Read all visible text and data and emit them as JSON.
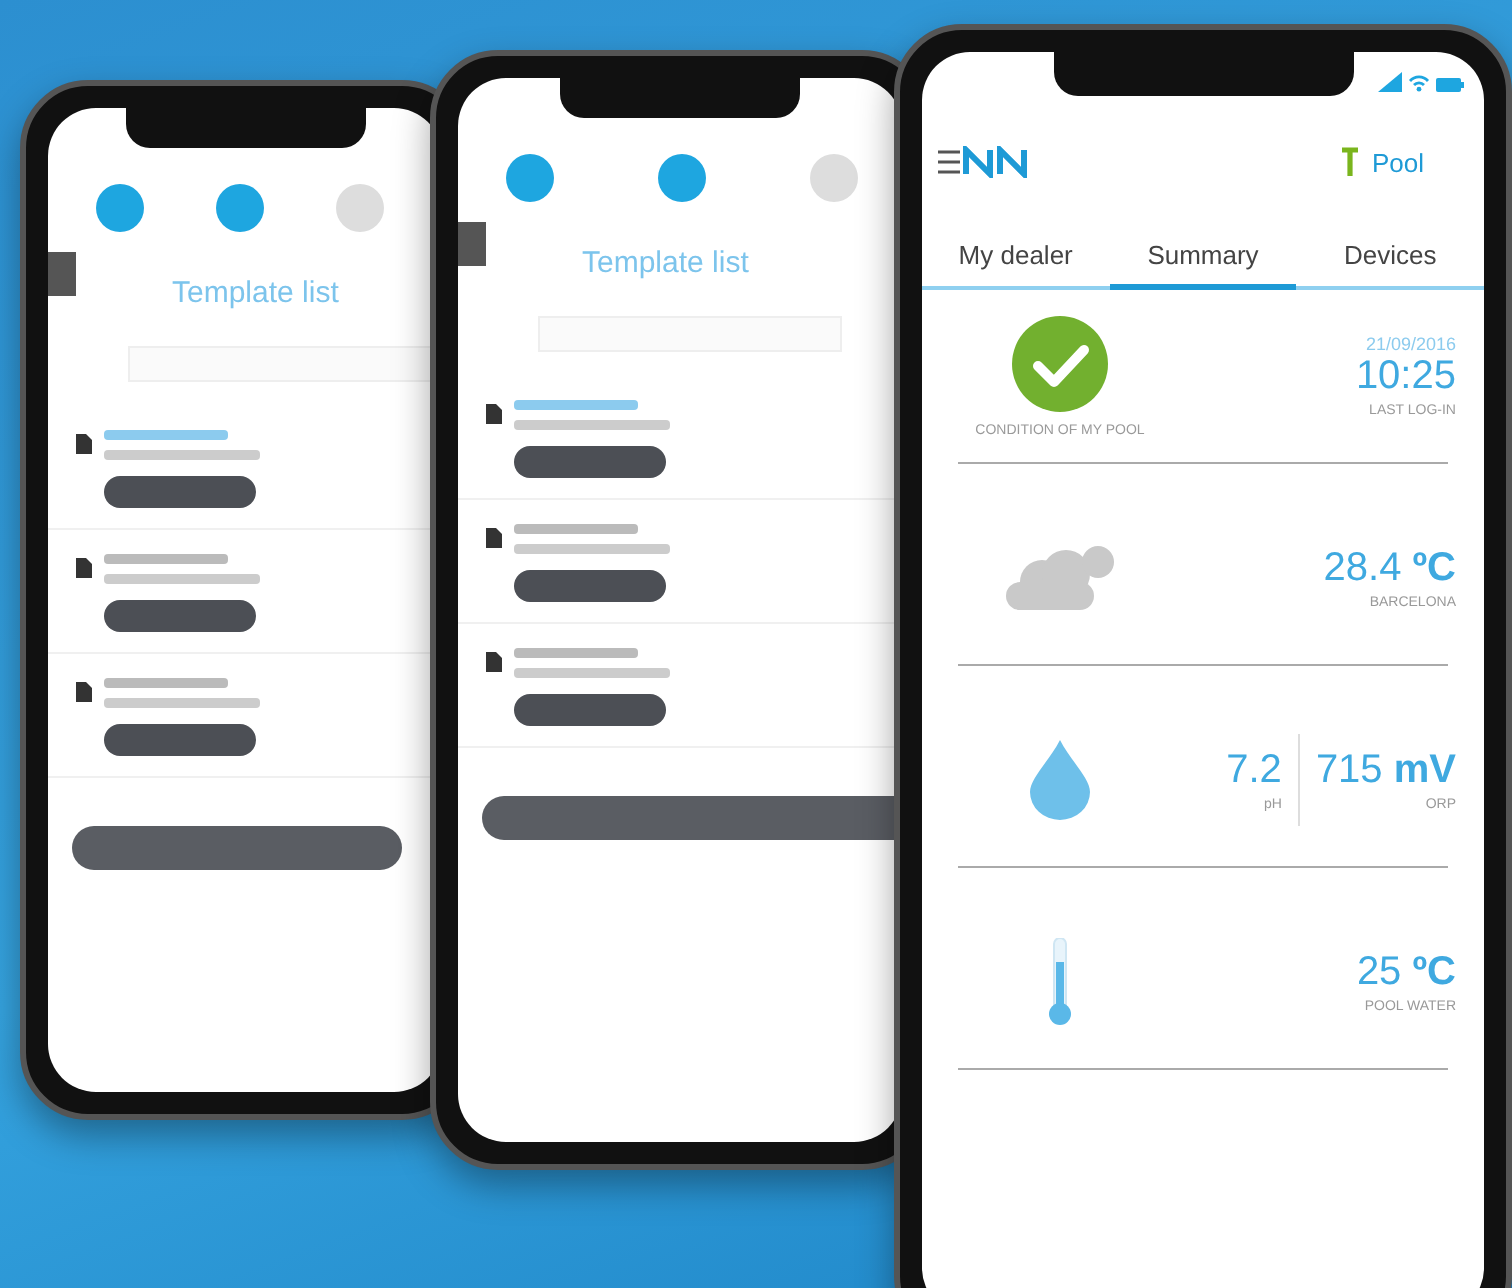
{
  "back_screens": [
    {
      "title": "Template list"
    },
    {
      "title": "Template list"
    }
  ],
  "header": {
    "pool_label": "Pool"
  },
  "tabs": [
    {
      "label": "My dealer",
      "selected": false
    },
    {
      "label": "Summary",
      "selected": true
    },
    {
      "label": "Devices",
      "selected": false
    }
  ],
  "rows": [
    {
      "kind": "condition",
      "caption": "CONDITION OF MY POOL",
      "date": "21/09/2016",
      "time": "10:25",
      "time_caption": "LAST LOG-IN"
    },
    {
      "kind": "weather",
      "readings": [
        {
          "value": "28.4 **ºC**",
          "caption": "BARCELONA"
        }
      ]
    },
    {
      "kind": "water",
      "readings": [
        {
          "value": "7.2",
          "caption": "pH"
        },
        {
          "value": "715 **mV**",
          "caption": "ORP"
        }
      ]
    },
    {
      "kind": "temperature",
      "readings": [
        {
          "value": "25 **ºC**",
          "caption": "POOL WATER"
        }
      ]
    }
  ]
}
